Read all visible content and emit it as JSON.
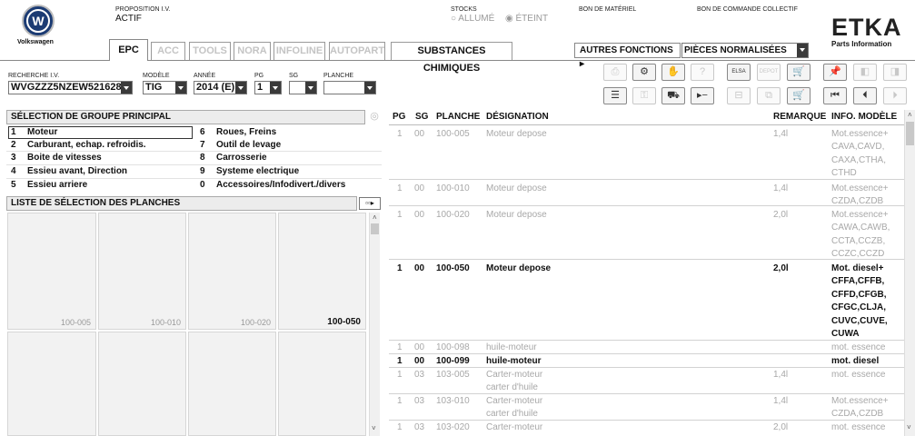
{
  "header": {
    "brand": "Volkswagen",
    "proposition_label": "PROPOSITION I.V.",
    "proposition_value": "ACTIF",
    "stocks_label": "STOCKS",
    "stock_on": "ALLUMÉ",
    "stock_off": "ÉTEINT",
    "bon_materiel": "BON DE MATÉRIEL",
    "bon_commande": "BON DE COMMANDE COLLECTIF",
    "etka": "ETKA",
    "etka_sub": "Parts Information"
  },
  "tabs": [
    "EPC",
    "ACC",
    "TOOLS",
    "NORA",
    "INFOLINE",
    "AUTOPART",
    "SUBSTANCES CHIMIQUES"
  ],
  "functions": {
    "label": "AUTRES FONCTIONS ▸",
    "select": "PIÈCES NORMALISÉES"
  },
  "search": {
    "vin_label": "RECHERCHE I.V.",
    "vin": "WVGZZZ5NZEW521628",
    "model_label": "MODÈLE",
    "model": "TIG",
    "year_label": "ANNÉE",
    "year": "2014 (E)",
    "pg_label": "PG",
    "pg": "1",
    "sg_label": "SG",
    "sg": "",
    "planche_label": "PLANCHE",
    "planche": ""
  },
  "groups": {
    "title": "SÉLECTION DE GROUPE PRINCIPAL",
    "left": [
      {
        "n": "1",
        "t": "Moteur"
      },
      {
        "n": "2",
        "t": "Carburant, echap. refroidis."
      },
      {
        "n": "3",
        "t": "Boite de vitesses"
      },
      {
        "n": "4",
        "t": "Essieu avant, Direction"
      },
      {
        "n": "5",
        "t": "Essieu arriere"
      }
    ],
    "right": [
      {
        "n": "6",
        "t": "Roues, Freins"
      },
      {
        "n": "7",
        "t": "Outil de levage"
      },
      {
        "n": "8",
        "t": "Carrosserie"
      },
      {
        "n": "9",
        "t": "Systeme electrique"
      },
      {
        "n": "0",
        "t": "Accessoires/Infodivert./divers"
      }
    ]
  },
  "planches": {
    "title": "LISTE DE SÉLECTION DES PLANCHES",
    "items": [
      "100-005",
      "100-010",
      "100-020",
      "100-050"
    ]
  },
  "table": {
    "headers": {
      "pg": "PG",
      "sg": "SG",
      "planche": "PLANCHE",
      "designation": "DÉSIGNATION",
      "remarque": "REMARQUE",
      "info": "INFO. MODÈLE"
    },
    "rows": [
      {
        "pg": "1",
        "sg": "00",
        "planche": "100-005",
        "des": "Moteur depose",
        "rem": "1,4l",
        "info": "Mot.essence+ CAVA,CAVD, CAXA,CTHA, CTHD"
      },
      {
        "pg": "1",
        "sg": "00",
        "planche": "100-010",
        "des": "Moteur depose",
        "rem": "1,4l",
        "info": "Mot.essence+ CZDA,CZDB"
      },
      {
        "pg": "1",
        "sg": "00",
        "planche": "100-020",
        "des": "Moteur depose",
        "rem": "2,0l",
        "info": "Mot.essence+ CAWA,CAWB, CCTA,CCZB, CCZC,CCZD"
      },
      {
        "pg": "1",
        "sg": "00",
        "planche": "100-050",
        "des": "Moteur depose",
        "rem": "2,0l",
        "info": "Mot. diesel+ CFFA,CFFB, CFFD,CFGB, CFGC,CLJA, CUVC,CUVE, CUWA"
      },
      {
        "pg": "1",
        "sg": "00",
        "planche": "100-098",
        "des": "huile-moteur",
        "rem": "",
        "info": "mot. essence"
      },
      {
        "pg": "1",
        "sg": "00",
        "planche": "100-099",
        "des": "huile-moteur",
        "rem": "",
        "info": "mot. diesel"
      },
      {
        "pg": "1",
        "sg": "03",
        "planche": "103-005",
        "des": "Carter-moteur carter d'huile",
        "rem": "1,4l",
        "info": "mot. essence"
      },
      {
        "pg": "1",
        "sg": "03",
        "planche": "103-010",
        "des": "Carter-moteur carter d'huile",
        "rem": "1,4l",
        "info": "Mot.essence+ CZDA,CZDB"
      },
      {
        "pg": "1",
        "sg": "03",
        "planche": "103-020",
        "des": "Carter-moteur",
        "rem": "2,0l",
        "info": "mot. essence"
      }
    ]
  }
}
